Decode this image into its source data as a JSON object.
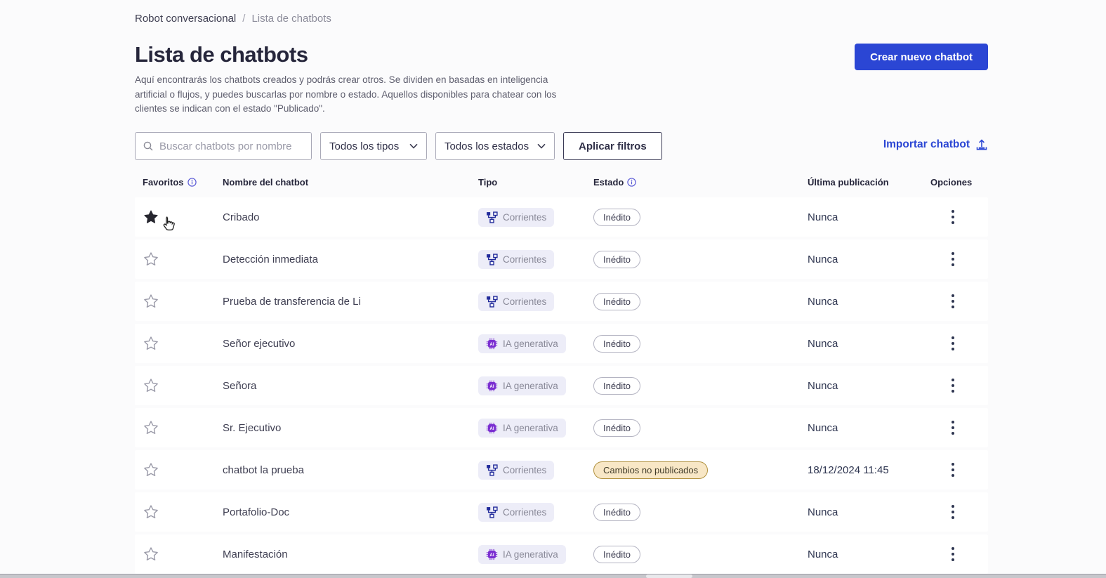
{
  "breadcrumb": {
    "parent": "Robot conversacional",
    "separator": "/",
    "current": "Lista de chatbots"
  },
  "header": {
    "title": "Lista de chatbots",
    "description": "Aquí encontrarás los chatbots creados y podrás crear otros. Se dividen en basadas en inteligencia artificial o flujos, y puedes buscarlas por nombre o estado. Aquellos disponibles para chatear con los clientes se indican con el estado \"Publicado\".",
    "create_button": "Crear nuevo chatbot"
  },
  "filters": {
    "search_placeholder": "Buscar chatbots por nombre",
    "type_filter": "Todos los tipos",
    "state_filter": "Todos los estados",
    "apply_button": "Aplicar filtros",
    "import_link": "Importar chatbot"
  },
  "table": {
    "headers": {
      "favorites": "Favoritos",
      "name": "Nombre del chatbot",
      "type": "Tipo",
      "state": "Estado",
      "last_publication": "Última publicación",
      "options": "Opciones"
    },
    "rows": [
      {
        "favorite": true,
        "name": "Cribado",
        "type_label": "Corrientes",
        "type_kind": "flow",
        "state_label": "Inédito",
        "state_kind": "default",
        "last_publication": "Nunca"
      },
      {
        "favorite": false,
        "name": "Detección inmediata",
        "type_label": "Corrientes",
        "type_kind": "flow",
        "state_label": "Inédito",
        "state_kind": "default",
        "last_publication": "Nunca"
      },
      {
        "favorite": false,
        "name": "Prueba de transferencia de Li",
        "type_label": "Corrientes",
        "type_kind": "flow",
        "state_label": "Inédito",
        "state_kind": "default",
        "last_publication": "Nunca"
      },
      {
        "favorite": false,
        "name": "Señor ejecutivo",
        "type_label": "IA generativa",
        "type_kind": "ai",
        "state_label": "Inédito",
        "state_kind": "default",
        "last_publication": "Nunca"
      },
      {
        "favorite": false,
        "name": "Señora",
        "type_label": "IA generativa",
        "type_kind": "ai",
        "state_label": "Inédito",
        "state_kind": "default",
        "last_publication": "Nunca"
      },
      {
        "favorite": false,
        "name": "Sr. Ejecutivo",
        "type_label": "IA generativa",
        "type_kind": "ai",
        "state_label": "Inédito",
        "state_kind": "default",
        "last_publication": "Nunca"
      },
      {
        "favorite": false,
        "name": "chatbot la prueba",
        "type_label": "Corrientes",
        "type_kind": "flow",
        "state_label": "Cambios no publicados",
        "state_kind": "warning",
        "last_publication": "18/12/2024 11:45"
      },
      {
        "favorite": false,
        "name": "Portafolio-Doc",
        "type_label": "Corrientes",
        "type_kind": "flow",
        "state_label": "Inédito",
        "state_kind": "default",
        "last_publication": "Nunca"
      },
      {
        "favorite": false,
        "name": "Manifestación",
        "type_label": "IA generativa",
        "type_kind": "ai",
        "state_label": "Inédito",
        "state_kind": "default",
        "last_publication": "Nunca"
      }
    ]
  },
  "colors": {
    "accent": "#2B46D4",
    "flow_icon": "#232C9B",
    "ai_icon": "#7B2FD1",
    "type_badge_bg": "#EDEDF8",
    "warning_bg": "#F8E7C6",
    "warning_border": "#B2923F",
    "star_filled": "#26262F",
    "text_dark": "#26263B",
    "text_muted": "#5E5E6E"
  }
}
